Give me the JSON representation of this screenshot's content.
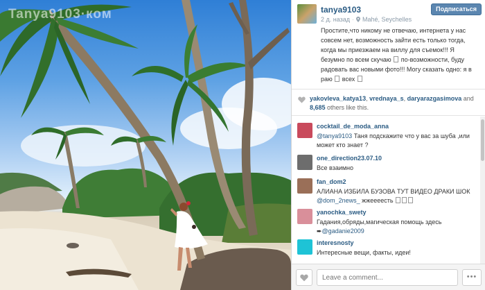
{
  "photo": {
    "watermark": "Tanya9103·ком",
    "description_colors": {
      "sky": "#3f8ad9",
      "sand": "#efe6d5",
      "dress": "#ffffff",
      "flower": "#d4283c"
    }
  },
  "post": {
    "username": "tanya9103",
    "time": "2 д. назад",
    "location": "Mahé, Seychelles",
    "follow_label": "Подписаться",
    "caption": [
      "Простите,что никому не отвечаю, интернета у нас",
      "совсем нет, возможность зайти есть только тогда,",
      "когда мы приезжаем на виллу для съемок!!! Я",
      "безумно по всем скучаю",
      "по-возможности, буду",
      "радовать вас новыми фото!!! Могу сказать одно: я в",
      "раю",
      "всех"
    ]
  },
  "likes": {
    "user1": "yakovleva_katya13",
    "user2": "vrednaya_s",
    "user3": "daryarazgasimova",
    "and": "and",
    "count": "8,685",
    "others": "others like this."
  },
  "comments": [
    {
      "user": "cocktail_de_moda_anna",
      "mention": "@tanya9103",
      "text": " Таня подскажите что у вас за шуба ,или может кто знает ?",
      "avatar_color": "#c94a5c"
    },
    {
      "user": "one_direction23.07.10",
      "mention": "",
      "text": "Все взаимно",
      "avatar_color": "#6d6d6d"
    },
    {
      "user": "fan_dom2",
      "mention": "",
      "text": "АЛИАНА ИЗБИЛА БУЗОВА ТУТ ВИДЕО ДРАКИ ШОК",
      "avatar_color": "#9a6f58"
    },
    {
      "user": "",
      "mention": "@dom_2news_",
      "text": " жжеееесть",
      "avatar_color": ""
    },
    {
      "user": "yanochka_swety",
      "mention": "",
      "text": "Гадания,обряды,магическая помощь здесь",
      "avatar_color": "#d98f9a"
    },
    {
      "user": "",
      "mention": "@gadanie2009",
      "text": "",
      "avatar_color": ""
    },
    {
      "user": "interesnosty",
      "mention": "",
      "text": "Интересные вещи, факты, идеи!",
      "avatar_color": "#1ec3d6"
    }
  ],
  "footer": {
    "comment_placeholder": "Leave a comment...",
    "more_label": "•••"
  }
}
